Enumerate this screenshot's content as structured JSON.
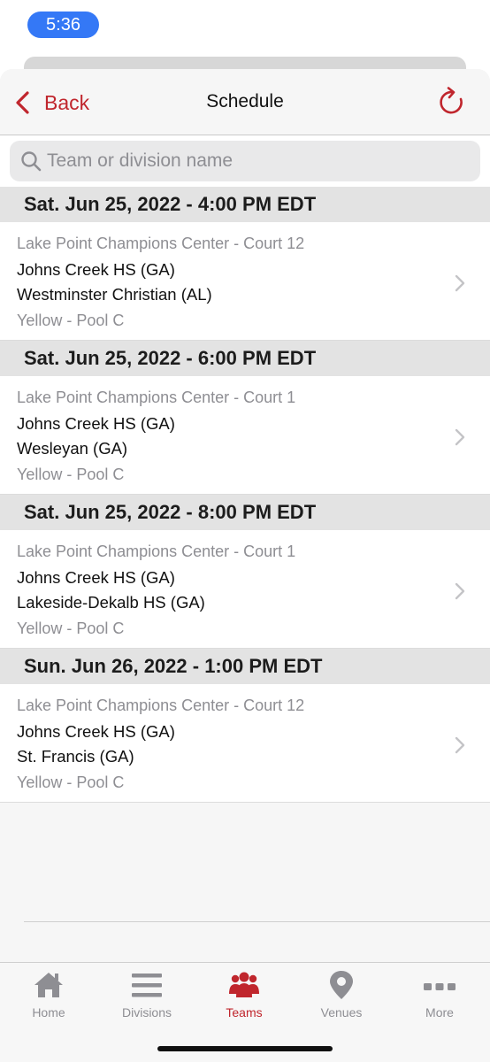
{
  "status_bar": {
    "time": "5:36",
    "pill_color": "#3478f6"
  },
  "nav": {
    "back_label": "Back",
    "title": "Schedule",
    "accent_color": "#c0262d",
    "back_icon": "chevron-left-icon",
    "refresh_icon": "refresh-icon"
  },
  "search": {
    "placeholder": "Team or division name",
    "value": "",
    "icon": "search-icon"
  },
  "schedule": [
    {
      "header": "Sat. Jun 25, 2022 - 4:00 PM EDT",
      "venue": "Lake Point Champions Center - Court 12",
      "team1": "Johns Creek HS (GA)",
      "team2": "Westminster Christian (AL)",
      "division": "Yellow - Pool C"
    },
    {
      "header": "Sat. Jun 25, 2022 - 6:00 PM EDT",
      "venue": "Lake Point Champions Center - Court 1",
      "team1": "Johns Creek HS (GA)",
      "team2": "Wesleyan (GA)",
      "division": "Yellow - Pool C"
    },
    {
      "header": "Sat. Jun 25, 2022 - 8:00 PM EDT",
      "venue": "Lake Point Champions Center - Court 1",
      "team1": "Johns Creek HS (GA)",
      "team2": "Lakeside-Dekalb HS (GA)",
      "division": "Yellow - Pool C"
    },
    {
      "header": "Sun. Jun 26, 2022 - 1:00 PM EDT",
      "venue": "Lake Point Champions Center - Court 12",
      "team1": "Johns Creek HS (GA)",
      "team2": "St. Francis (GA)",
      "division": "Yellow - Pool C"
    }
  ],
  "tabbar": {
    "active_color": "#c0262d",
    "inactive_color": "#8e8e93",
    "tabs": [
      {
        "label": "Home",
        "icon": "home-icon",
        "active": false
      },
      {
        "label": "Divisions",
        "icon": "list-icon",
        "active": false
      },
      {
        "label": "Teams",
        "icon": "group-icon",
        "active": true
      },
      {
        "label": "Venues",
        "icon": "location-pin-icon",
        "active": false
      },
      {
        "label": "More",
        "icon": "more-dots-icon",
        "active": false
      }
    ]
  }
}
